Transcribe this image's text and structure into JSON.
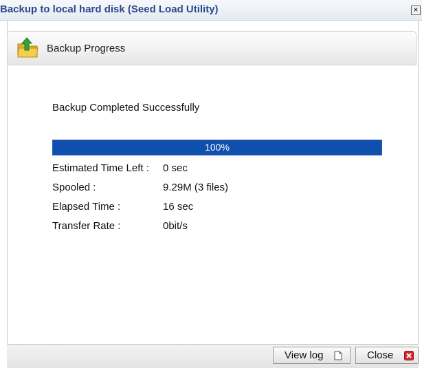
{
  "window": {
    "title": "Backup to local hard disk (Seed Load Utility)",
    "close_glyph": "×"
  },
  "section": {
    "title": "Backup Progress",
    "icon": "folder-upload-icon"
  },
  "status": {
    "message": "Backup Completed Successfully"
  },
  "progress": {
    "percent": 100,
    "label": "100%",
    "color": "#0f4fae"
  },
  "info": [
    {
      "label": "Estimated Time Left :",
      "value": "0 sec"
    },
    {
      "label": "Spooled :",
      "value": "9.29M (3 files)"
    },
    {
      "label": "Elapsed Time :",
      "value": "16 sec"
    },
    {
      "label": "Transfer Rate :",
      "value": "0bit/s"
    }
  ],
  "buttons": {
    "view_log": {
      "label": "View log",
      "icon": "document-icon"
    },
    "close": {
      "label": "Close",
      "icon": "close-red-icon",
      "color": "#d8282c"
    }
  }
}
